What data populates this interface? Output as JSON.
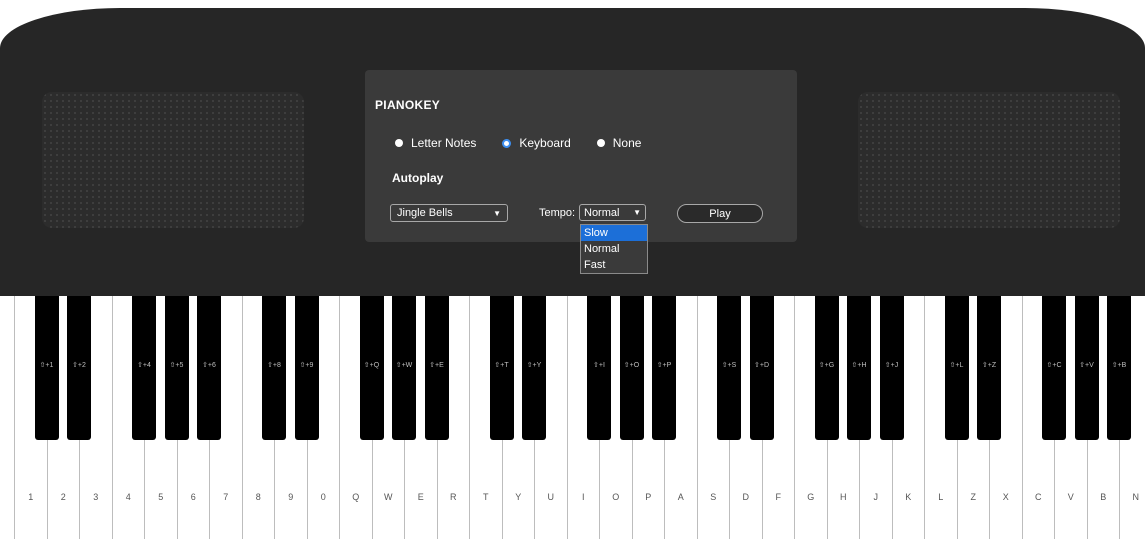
{
  "panel": {
    "brand": "PIANOKEY",
    "radio_options": [
      {
        "label": "Letter Notes",
        "selected": false
      },
      {
        "label": "Keyboard",
        "selected": true
      },
      {
        "label": "None",
        "selected": false
      }
    ],
    "autoplay_label": "Autoplay",
    "song_select_value": "Jingle Bells",
    "tempo_label": "Tempo",
    "tempo_select_value": "Normal",
    "tempo_options": [
      "Slow",
      "Normal",
      "Fast"
    ],
    "tempo_highlighted": "Slow",
    "play_label": "Play"
  },
  "colors": {
    "piano_body": "#262626",
    "panel": "#3a3a3a",
    "selected_radio": "#3d8ff1",
    "dropdown_highlight": "#1c6fd8"
  },
  "keys": {
    "white": [
      "1",
      "2",
      "3",
      "4",
      "5",
      "6",
      "7",
      "8",
      "9",
      "0",
      "Q",
      "W",
      "E",
      "R",
      "T",
      "Y",
      "U",
      "I",
      "O",
      "P",
      "A",
      "S",
      "D",
      "F",
      "G",
      "H",
      "J",
      "K",
      "L",
      "Z",
      "X",
      "C",
      "V",
      "B",
      "N"
    ],
    "black": [
      "⇧+1",
      "⇧+2",
      "⇧+4",
      "⇧+5",
      "⇧+6",
      "⇧+8",
      "⇧+9",
      "⇧+Q",
      "⇧+W",
      "⇧+E",
      "⇧+T",
      "⇧+Y",
      "⇧+I",
      "⇧+O",
      "⇧+P",
      "⇧+S",
      "⇧+D",
      "⇧+G",
      "⇧+H",
      "⇧+J",
      "⇧+L",
      "⇧+Z",
      "⇧+C",
      "⇧+V",
      "⇧+B"
    ]
  }
}
